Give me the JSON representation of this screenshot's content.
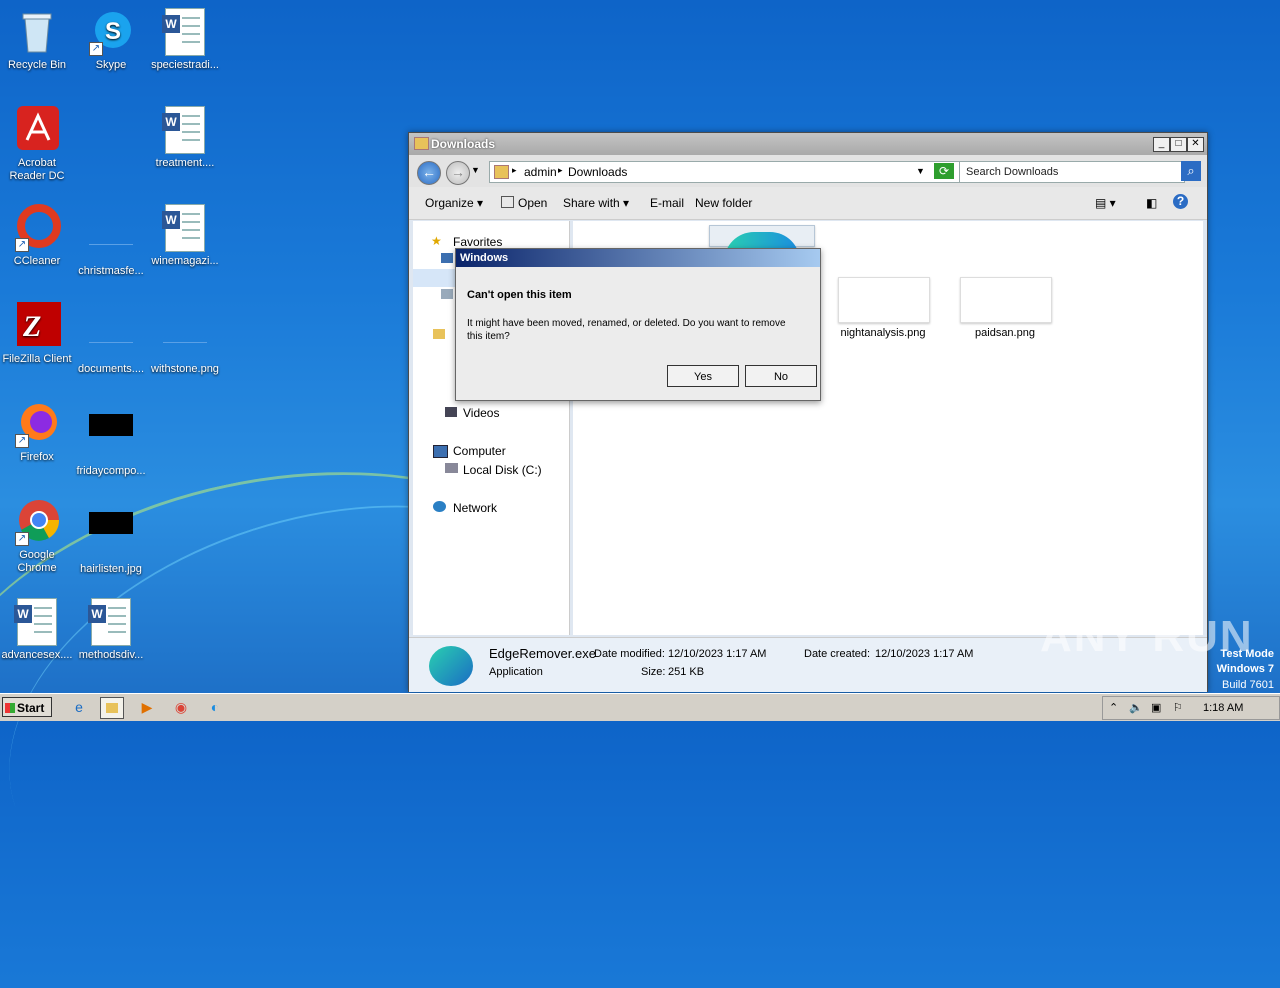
{
  "desktop": {
    "icons": [
      {
        "label": "Recycle Bin"
      },
      {
        "label": "Skype"
      },
      {
        "label": "speciestradi..."
      },
      {
        "label": "Acrobat Reader DC"
      },
      {
        "label": "treatment...."
      },
      {
        "label": "CCleaner"
      },
      {
        "label": "christmasfe..."
      },
      {
        "label": "winemagazi..."
      },
      {
        "label": "FileZilla Client"
      },
      {
        "label": "documents...."
      },
      {
        "label": "withstone.png"
      },
      {
        "label": "Firefox"
      },
      {
        "label": "fridaycompo..."
      },
      {
        "label": "Google Chrome"
      },
      {
        "label": "hairlisten.jpg"
      },
      {
        "label": "advancesex...."
      },
      {
        "label": "methodsdiv..."
      }
    ]
  },
  "explorer": {
    "title": "Downloads",
    "breadcrumb": [
      "admin",
      "Downloads"
    ],
    "search_placeholder": "Search Downloads",
    "toolbar": {
      "organize": "Organize",
      "open": "Open",
      "share_with": "Share with",
      "email": "E-mail",
      "new_folder": "New folder"
    },
    "nav": {
      "favorites": "Favorites",
      "videos": "Videos",
      "computer": "Computer",
      "local_disk": "Local Disk (C:)",
      "network": "Network"
    },
    "files": [
      {
        "name": "nightanalysis.png"
      },
      {
        "name": "paidsan.png"
      }
    ],
    "details": {
      "filename": "EdgeRemover.exe",
      "type": "Application",
      "date_modified_label": "Date modified:",
      "date_modified": "12/10/2023 1:17 AM",
      "size_label": "Size:",
      "size": "251 KB",
      "date_created_label": "Date created:",
      "date_created": "12/10/2023 1:17 AM"
    }
  },
  "dialog": {
    "title": "Windows",
    "heading": "Can't open this item",
    "message": "It might have been moved, renamed, or deleted. Do you want to remove this item?",
    "yes": "Yes",
    "no": "No"
  },
  "taskbar": {
    "start": "Start",
    "clock": "1:18 AM"
  },
  "watermark": {
    "line1": "Test Mode",
    "line2": "Windows 7",
    "line3": "Build 7601",
    "brand": "ANY RUN"
  }
}
